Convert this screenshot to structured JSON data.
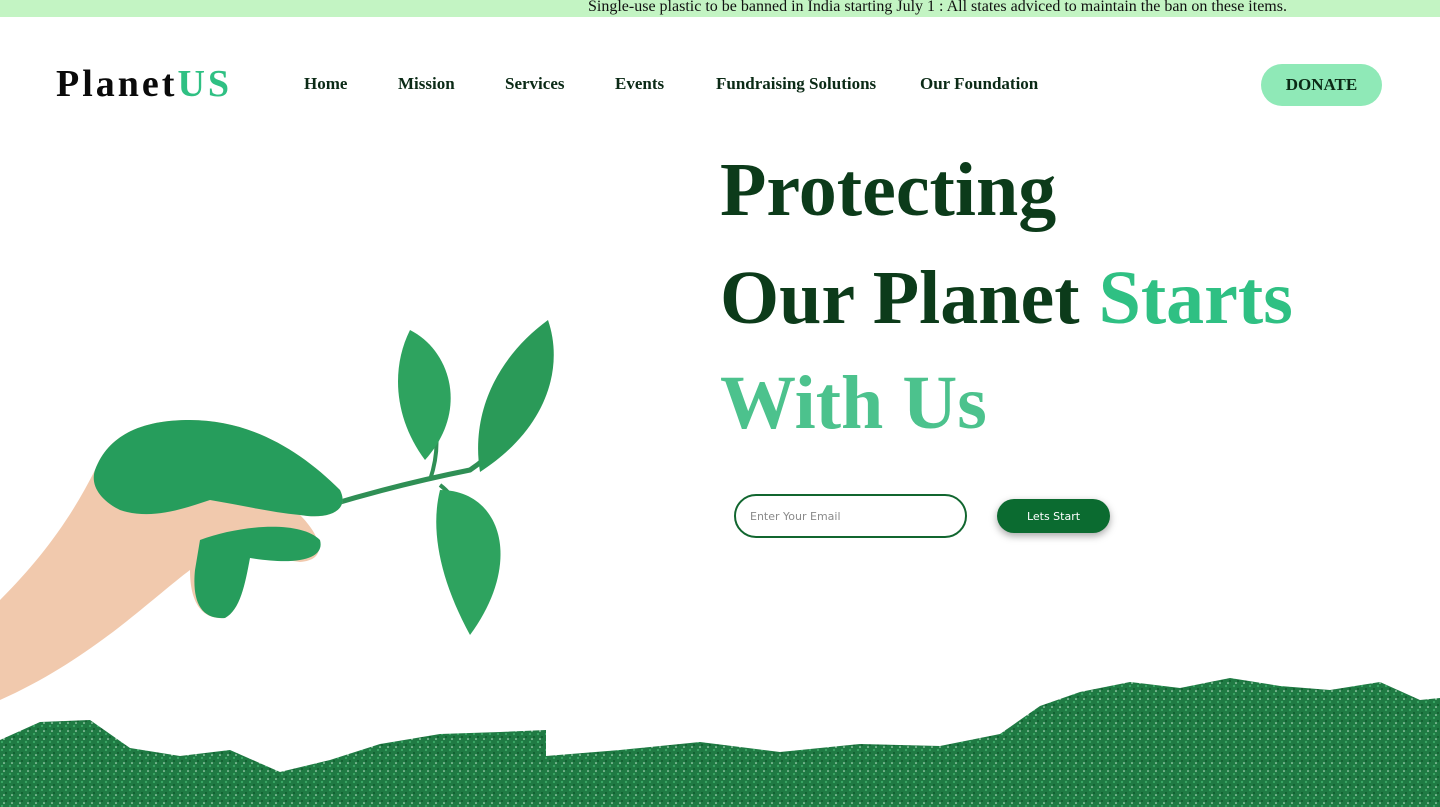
{
  "ticker": {
    "text": "Single-use plastic to be banned in India starting July 1 : All states adviced to maintain the ban on these items."
  },
  "brand": {
    "part1": "Planet",
    "part2": "US"
  },
  "nav": {
    "items": [
      "Home",
      "Mission",
      "Services",
      "Events",
      "Fundraising Solutions",
      "Our Foundation"
    ]
  },
  "donate": {
    "label": "DONATE"
  },
  "hero": {
    "line1": "Protecting",
    "line2_dark": "Our Planet",
    "line2_accent": "Starts",
    "line3": "With Us"
  },
  "signup": {
    "email_placeholder": "Enter Your Email",
    "email_value": "",
    "button_label": "Lets Start"
  },
  "images": {
    "hand": "hand-holding-green-leaf-sprig",
    "ground": "green-painted-grass-strip"
  },
  "colors": {
    "ticker_bg": "#c3f4c3",
    "accent": "#2fc083",
    "dark_green": "#0c3b1a",
    "donate_bg": "#8fe9b7",
    "button_bg": "#0b6b30"
  }
}
